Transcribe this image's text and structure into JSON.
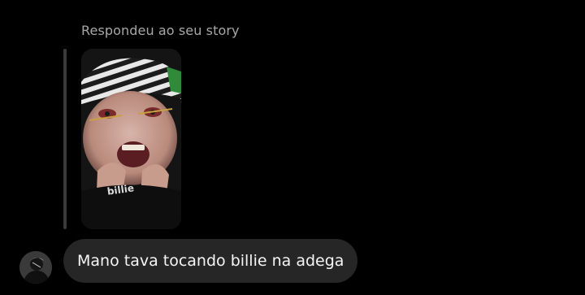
{
  "thread": {
    "reply_context": "Respondeu ao seu story",
    "message_text": "Mano tava tocando billie na adega"
  },
  "story": {
    "image": "story-photo",
    "sweater_text": "billie"
  },
  "sender": {
    "avatar": "user-avatar"
  },
  "colors": {
    "background": "#000000",
    "bubble": "#262626",
    "secondary_text": "#a8a8a8",
    "primary_text": "#f5f5f5",
    "quote_bar": "#3a3a3a"
  }
}
